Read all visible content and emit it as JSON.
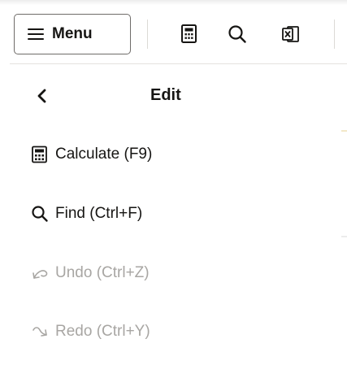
{
  "toolbar": {
    "menu_label": "Menu",
    "icons": [
      "calculate-icon",
      "search-icon",
      "export-excel-icon"
    ]
  },
  "submenu": {
    "title": "Edit",
    "back_icon": "chevron-left-icon",
    "items": [
      {
        "label": "Calculate (F9)",
        "icon": "calculate-icon",
        "enabled": true
      },
      {
        "label": "Find (Ctrl+F)",
        "icon": "search-icon",
        "enabled": true
      },
      {
        "label": "Undo (Ctrl+Z)",
        "icon": "undo-icon",
        "enabled": false
      },
      {
        "label": "Redo (Ctrl+Y)",
        "icon": "redo-icon",
        "enabled": false
      }
    ]
  },
  "colors": {
    "text": "#161513",
    "disabled_text": "#a8a6a3",
    "border": "#6f6c69",
    "separator": "#dcdad6"
  }
}
